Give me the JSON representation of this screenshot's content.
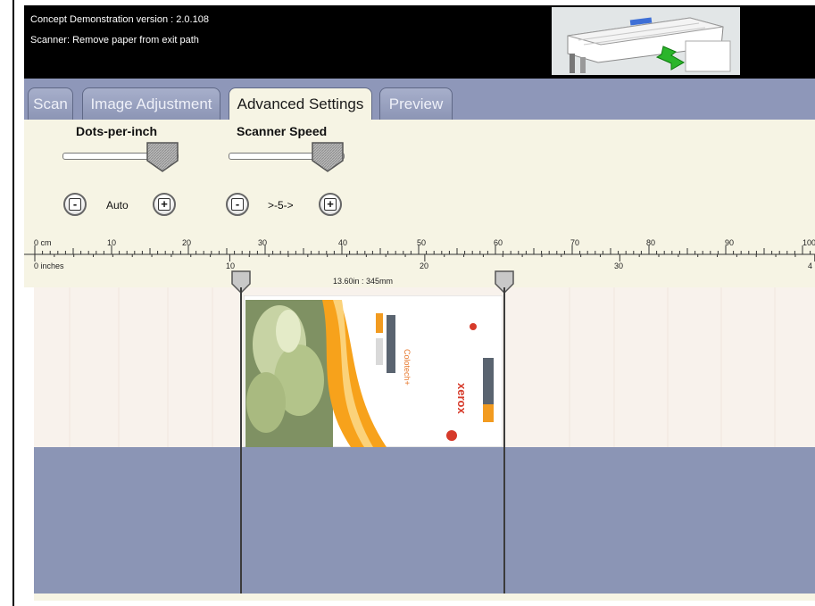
{
  "header": {
    "version_text": "Concept Demonstration version : 2.0.108",
    "status_text": "Scanner: Remove paper from exit path"
  },
  "tabs": [
    {
      "label": "Scan",
      "active": false
    },
    {
      "label": "Image Adjustment",
      "active": false
    },
    {
      "label": "Advanced Settings",
      "active": true
    },
    {
      "label": "Preview",
      "active": false
    }
  ],
  "controls": {
    "dpi": {
      "label": "Dots-per-inch",
      "value": "Auto",
      "minus": "-",
      "plus": "+"
    },
    "speed": {
      "label": "Scanner Speed",
      "value": ">-5->",
      "minus": "-",
      "plus": "+"
    }
  },
  "ruler": {
    "cm_unit": "0 cm",
    "cm_ticks": [
      "10",
      "20",
      "30",
      "40",
      "50",
      "60",
      "70",
      "80",
      "90",
      "100"
    ],
    "inch_unit": "0 inches",
    "inch_ticks": [
      "10",
      "20",
      "30",
      "4"
    ],
    "scan_size": "13.60in : 345mm"
  },
  "document": {
    "brand": "xerox",
    "product": "Colotech+"
  },
  "colors": {
    "header_bg": "#000000",
    "tab_bar": "#8e97b9",
    "panel_bg": "#f6f4e4",
    "lower_area": "#8b95b5"
  }
}
